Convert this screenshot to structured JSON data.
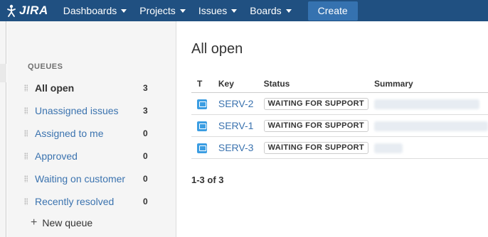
{
  "nav": {
    "logo_text": "JIRA",
    "items": [
      {
        "label": "Dashboards"
      },
      {
        "label": "Projects"
      },
      {
        "label": "Issues"
      },
      {
        "label": "Boards"
      }
    ],
    "create_label": "Create"
  },
  "sidebar": {
    "heading": "QUEUES",
    "queues": [
      {
        "label": "All open",
        "count": "3",
        "active": true
      },
      {
        "label": "Unassigned issues",
        "count": "3",
        "active": false
      },
      {
        "label": "Assigned to me",
        "count": "0",
        "active": false
      },
      {
        "label": "Approved",
        "count": "0",
        "active": false
      },
      {
        "label": "Waiting on customer",
        "count": "0",
        "active": false
      },
      {
        "label": "Recently resolved",
        "count": "0",
        "active": false
      }
    ],
    "new_queue_label": "New queue"
  },
  "main": {
    "title": "All open",
    "columns": {
      "type": "T",
      "key": "Key",
      "status": "Status",
      "summary": "Summary"
    },
    "issues": [
      {
        "key": "SERV-2",
        "status": "WAITING FOR SUPPORT"
      },
      {
        "key": "SERV-1",
        "status": "WAITING FOR SUPPORT"
      },
      {
        "key": "SERV-3",
        "status": "WAITING FOR SUPPORT"
      }
    ],
    "pagination": "1-3 of 3"
  },
  "colors": {
    "topbar": "#205081",
    "create_button": "#3572b0",
    "link": "#3b73af",
    "sidebar_bg": "#f5f5f5",
    "type_icon": "#3b9de2"
  },
  "icons": {
    "logo": "jira-logo-icon",
    "caret": "caret-down-icon",
    "drag": "drag-handle-icon",
    "plus": "plus-icon",
    "issue_type": "service-request-icon"
  }
}
